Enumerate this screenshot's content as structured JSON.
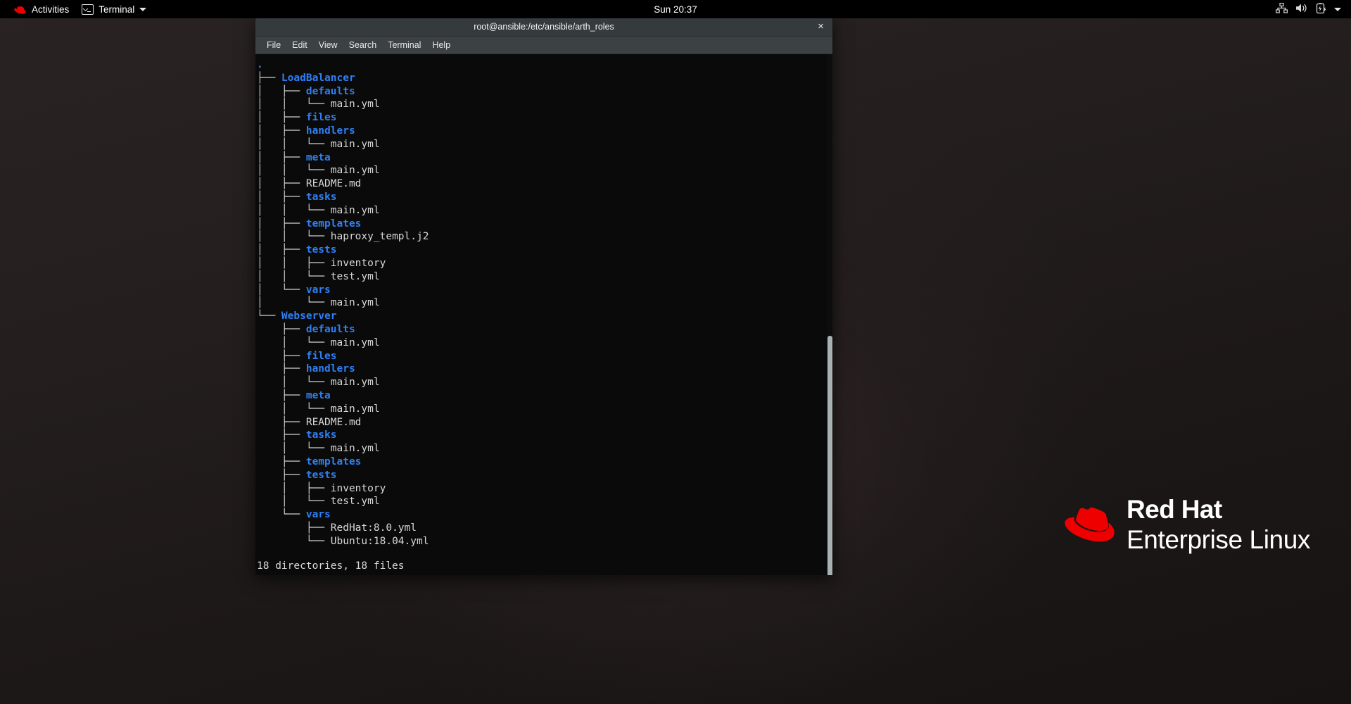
{
  "top_panel": {
    "activities_label": "Activities",
    "app_menu_label": "Terminal",
    "clock": "Sun 20:37",
    "icons": {
      "redhat": "redhat-logo-icon",
      "terminal": "terminal-icon",
      "app_caret": "chevron-down-icon",
      "network": "network-icon",
      "volume": "volume-icon",
      "battery": "battery-charging-icon",
      "system_caret": "chevron-down-icon"
    }
  },
  "window": {
    "title": "root@ansible:/etc/ansible/arth_roles",
    "close_label": "×",
    "menu": [
      {
        "label": "File"
      },
      {
        "label": "Edit"
      },
      {
        "label": "View"
      },
      {
        "label": "Search"
      },
      {
        "label": "Terminal"
      },
      {
        "label": "Help"
      }
    ]
  },
  "terminal": {
    "tree_lines": [
      {
        "prefix": "",
        "name": ".",
        "type": "dir"
      },
      {
        "prefix": "├── ",
        "name": "LoadBalancer",
        "type": "dir"
      },
      {
        "prefix": "│   ├── ",
        "name": "defaults",
        "type": "dir"
      },
      {
        "prefix": "│   │   └── ",
        "name": "main.yml",
        "type": "file"
      },
      {
        "prefix": "│   ├── ",
        "name": "files",
        "type": "dir"
      },
      {
        "prefix": "│   ├── ",
        "name": "handlers",
        "type": "dir"
      },
      {
        "prefix": "│   │   └── ",
        "name": "main.yml",
        "type": "file"
      },
      {
        "prefix": "│   ├── ",
        "name": "meta",
        "type": "dir"
      },
      {
        "prefix": "│   │   └── ",
        "name": "main.yml",
        "type": "file"
      },
      {
        "prefix": "│   ├── ",
        "name": "README.md",
        "type": "file"
      },
      {
        "prefix": "│   ├── ",
        "name": "tasks",
        "type": "dir"
      },
      {
        "prefix": "│   │   └── ",
        "name": "main.yml",
        "type": "file"
      },
      {
        "prefix": "│   ├── ",
        "name": "templates",
        "type": "dir"
      },
      {
        "prefix": "│   │   └── ",
        "name": "haproxy_templ.j2",
        "type": "file"
      },
      {
        "prefix": "│   ├── ",
        "name": "tests",
        "type": "dir"
      },
      {
        "prefix": "│   │   ├── ",
        "name": "inventory",
        "type": "file"
      },
      {
        "prefix": "│   │   └── ",
        "name": "test.yml",
        "type": "file"
      },
      {
        "prefix": "│   └── ",
        "name": "vars",
        "type": "dir"
      },
      {
        "prefix": "│       └── ",
        "name": "main.yml",
        "type": "file"
      },
      {
        "prefix": "└── ",
        "name": "Webserver",
        "type": "dir"
      },
      {
        "prefix": "    ├── ",
        "name": "defaults",
        "type": "dir"
      },
      {
        "prefix": "    │   └── ",
        "name": "main.yml",
        "type": "file"
      },
      {
        "prefix": "    ├── ",
        "name": "files",
        "type": "dir"
      },
      {
        "prefix": "    ├── ",
        "name": "handlers",
        "type": "dir"
      },
      {
        "prefix": "    │   └── ",
        "name": "main.yml",
        "type": "file"
      },
      {
        "prefix": "    ├── ",
        "name": "meta",
        "type": "dir"
      },
      {
        "prefix": "    │   └── ",
        "name": "main.yml",
        "type": "file"
      },
      {
        "prefix": "    ├── ",
        "name": "README.md",
        "type": "file"
      },
      {
        "prefix": "    ├── ",
        "name": "tasks",
        "type": "dir"
      },
      {
        "prefix": "    │   └── ",
        "name": "main.yml",
        "type": "file"
      },
      {
        "prefix": "    ├── ",
        "name": "templates",
        "type": "dir"
      },
      {
        "prefix": "    ├── ",
        "name": "tests",
        "type": "dir"
      },
      {
        "prefix": "    │   ├── ",
        "name": "inventory",
        "type": "file"
      },
      {
        "prefix": "    │   └── ",
        "name": "test.yml",
        "type": "file"
      },
      {
        "prefix": "    └── ",
        "name": "vars",
        "type": "dir"
      },
      {
        "prefix": "        ├── ",
        "name": "RedHat:8.0.yml",
        "type": "file"
      },
      {
        "prefix": "        └── ",
        "name": "Ubuntu:18.04.yml",
        "type": "file"
      }
    ],
    "summary": "18 directories, 18 files",
    "directory_count": 18,
    "file_count": 18
  },
  "branding": {
    "line1": "Red Hat",
    "line2": "Enterprise Linux",
    "logo": "redhat-fedora-logo-icon"
  },
  "colors": {
    "directory": "#2f7ff5",
    "file": "#d8d8d8",
    "terminal_bg": "#0a0a0a",
    "titlebar_bg": "#353a3c",
    "menubar_bg": "#3c4144",
    "redhat_red": "#ee0000",
    "panel_bg": "#000000"
  }
}
